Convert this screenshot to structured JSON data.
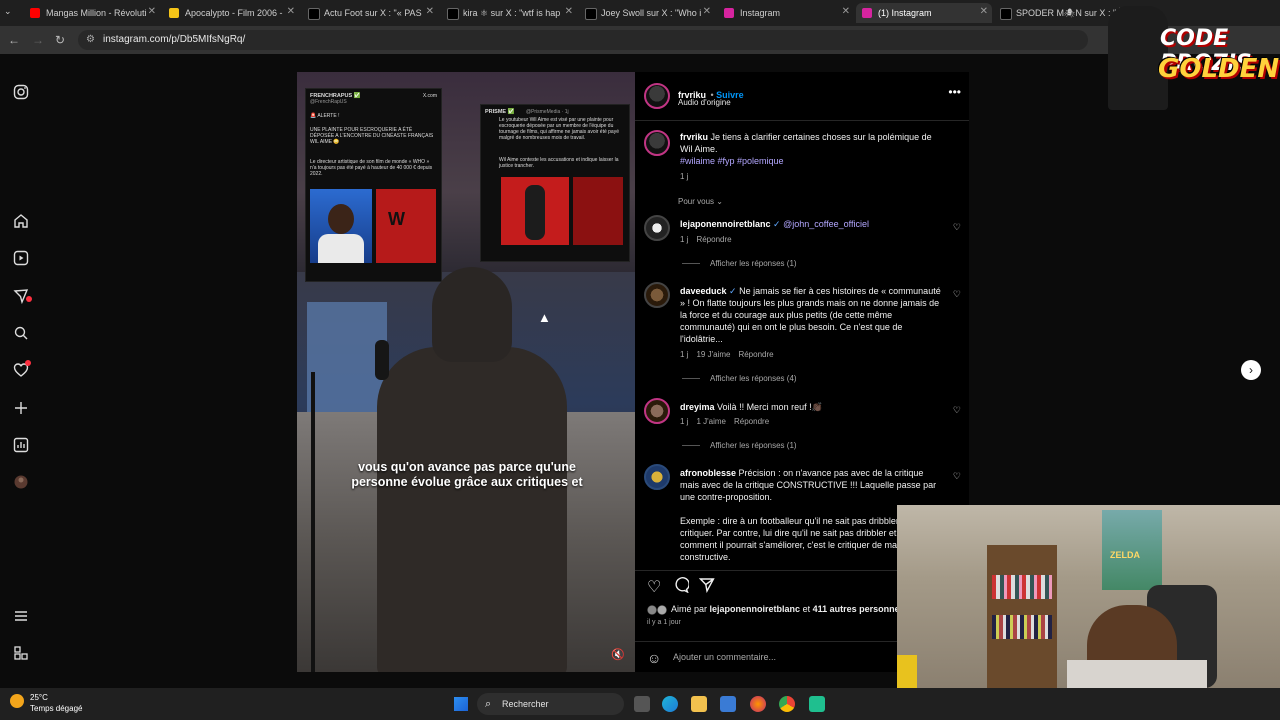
{
  "browser": {
    "tabs": [
      {
        "label": "Mangas Million - Révolution",
        "icon_color": "#ff0000"
      },
      {
        "label": "Apocalypto - Film 2006 -",
        "icon_color": "#f5c518"
      },
      {
        "label": "Actu Foot sur X : \"« PAS D",
        "icon_color": "#000000"
      },
      {
        "label": "kira ⚛ sur X : \"wtf is hap",
        "icon_color": "#000000"
      },
      {
        "label": "Joey Swoll sur X : \"Who is",
        "icon_color": "#000000"
      },
      {
        "label": "Instagram",
        "icon_color": "#d6249f"
      },
      {
        "label": "(1) Instagram",
        "icon_color": "#d6249f",
        "active": true
      },
      {
        "label": "SPODER M🕷N sur X : \"S",
        "icon_color": "#000000"
      }
    ],
    "url": "instagram.com/p/Db5MIfsNgRq/"
  },
  "sidebar": {
    "icons": [
      "instagram-logo-icon",
      "home-icon",
      "reels-icon",
      "messages-icon",
      "search-icon",
      "notifications-icon",
      "create-icon",
      "dashboard-icon",
      "profile-icon",
      "menu-icon",
      "threads-icon"
    ]
  },
  "media": {
    "card1": {
      "source": "FRENCHRAPUS ✅",
      "handle": "@FrenchRapUS",
      "alert": "🚨 ALERTE !",
      "text": "UNE PLAINTE POUR ESCROQUERIE A ÉTÉ DÉPOSÉE A L'ENCONTRE DU CINÉASTE FRANÇAIS WIL AIME 😳",
      "text2": "Le directeur artistique de son film de monde « WHO » n'a toujours pas été payé à hauteur de 40 000 € depuis 2022.",
      "xcom": "X.com"
    },
    "card2": {
      "source": "PRISME ✅",
      "handle": "@PrismeMedia · 1j",
      "text": "Le youtubeur Wil Aime est visé par une plainte pour escroquerie déposée par un membre de l'équipe du tournage de films, qui affirme ne jamais avoir été payé malgré de nombreuses mois de travail.",
      "text2": "Wil Aime conteste les accusations et indique laisser la justice trancher."
    },
    "subtitle": "vous qu'on avance pas parce qu'une personne évolue grâce aux critiques et"
  },
  "post": {
    "author": "frvriku",
    "follow": "Suivre",
    "audio": "Audio d'origine",
    "caption_author": "frvriku",
    "caption": "Je tiens à clarifier certaines choses sur la polémique de Wil Aime.",
    "hashtags": "#wilaime #fyp #polemique",
    "caption_time": "1 j",
    "for_you": "Pour vous ⌄",
    "comments": [
      {
        "user": "lejaponennoiretblanc",
        "verified": "✓",
        "text": "@john_coffee_officiel",
        "time": "1 j",
        "likes": "",
        "reply": "Répondre",
        "replies": "Afficher les réponses (1)"
      },
      {
        "user": "daveeduck",
        "verified": "✓",
        "text": "Ne jamais se fier à ces histoires de « communauté » ! On flatte toujours les plus grands mais on ne donne jamais de la force et du courage aux plus petits (de cette même communauté) qui en ont le plus besoin. Ce n'est que de l'idolâtrie...",
        "time": "1 j",
        "likes": "19 J'aime",
        "reply": "Répondre",
        "replies": "Afficher les réponses (4)"
      },
      {
        "user": "dreyima",
        "verified": "",
        "text": "Voilà !! Merci mon reuf !👏🏿",
        "time": "1 j",
        "likes": "1 J'aime",
        "reply": "Répondre",
        "replies": "Afficher les réponses (1)"
      },
      {
        "user": "afronoblesse",
        "verified": "",
        "text": "Précision : on n'avance pas avec de la critique mais avec de la critique CONSTRUCTIVE !!! Laquelle passe par une contre-proposition.",
        "text2": "Exemple : dire à un footballeur qu'il ne sait pas dribbler = critiquer. Par contre, lui dire qu'il ne sait pas dribbler et lui montrer comment il pourrait s'améliorer, c'est le critiquer de manière constructive."
      }
    ],
    "liked_prefix": "Aimé par",
    "liked_user": "lejaponennoiretblanc",
    "liked_mid": "et",
    "liked_others": "411 autres personnes",
    "posted_ago": "il y a 1 jour",
    "add_comment": "Ajouter un commentaire..."
  },
  "overlay": {
    "logo_line1": "CODE PROZIS",
    "logo_line2": "GOLDENG",
    "poster_text": "ZELDA"
  },
  "taskbar": {
    "temp": "25°C",
    "weather": "Temps dégagé",
    "search": "Rechercher"
  }
}
